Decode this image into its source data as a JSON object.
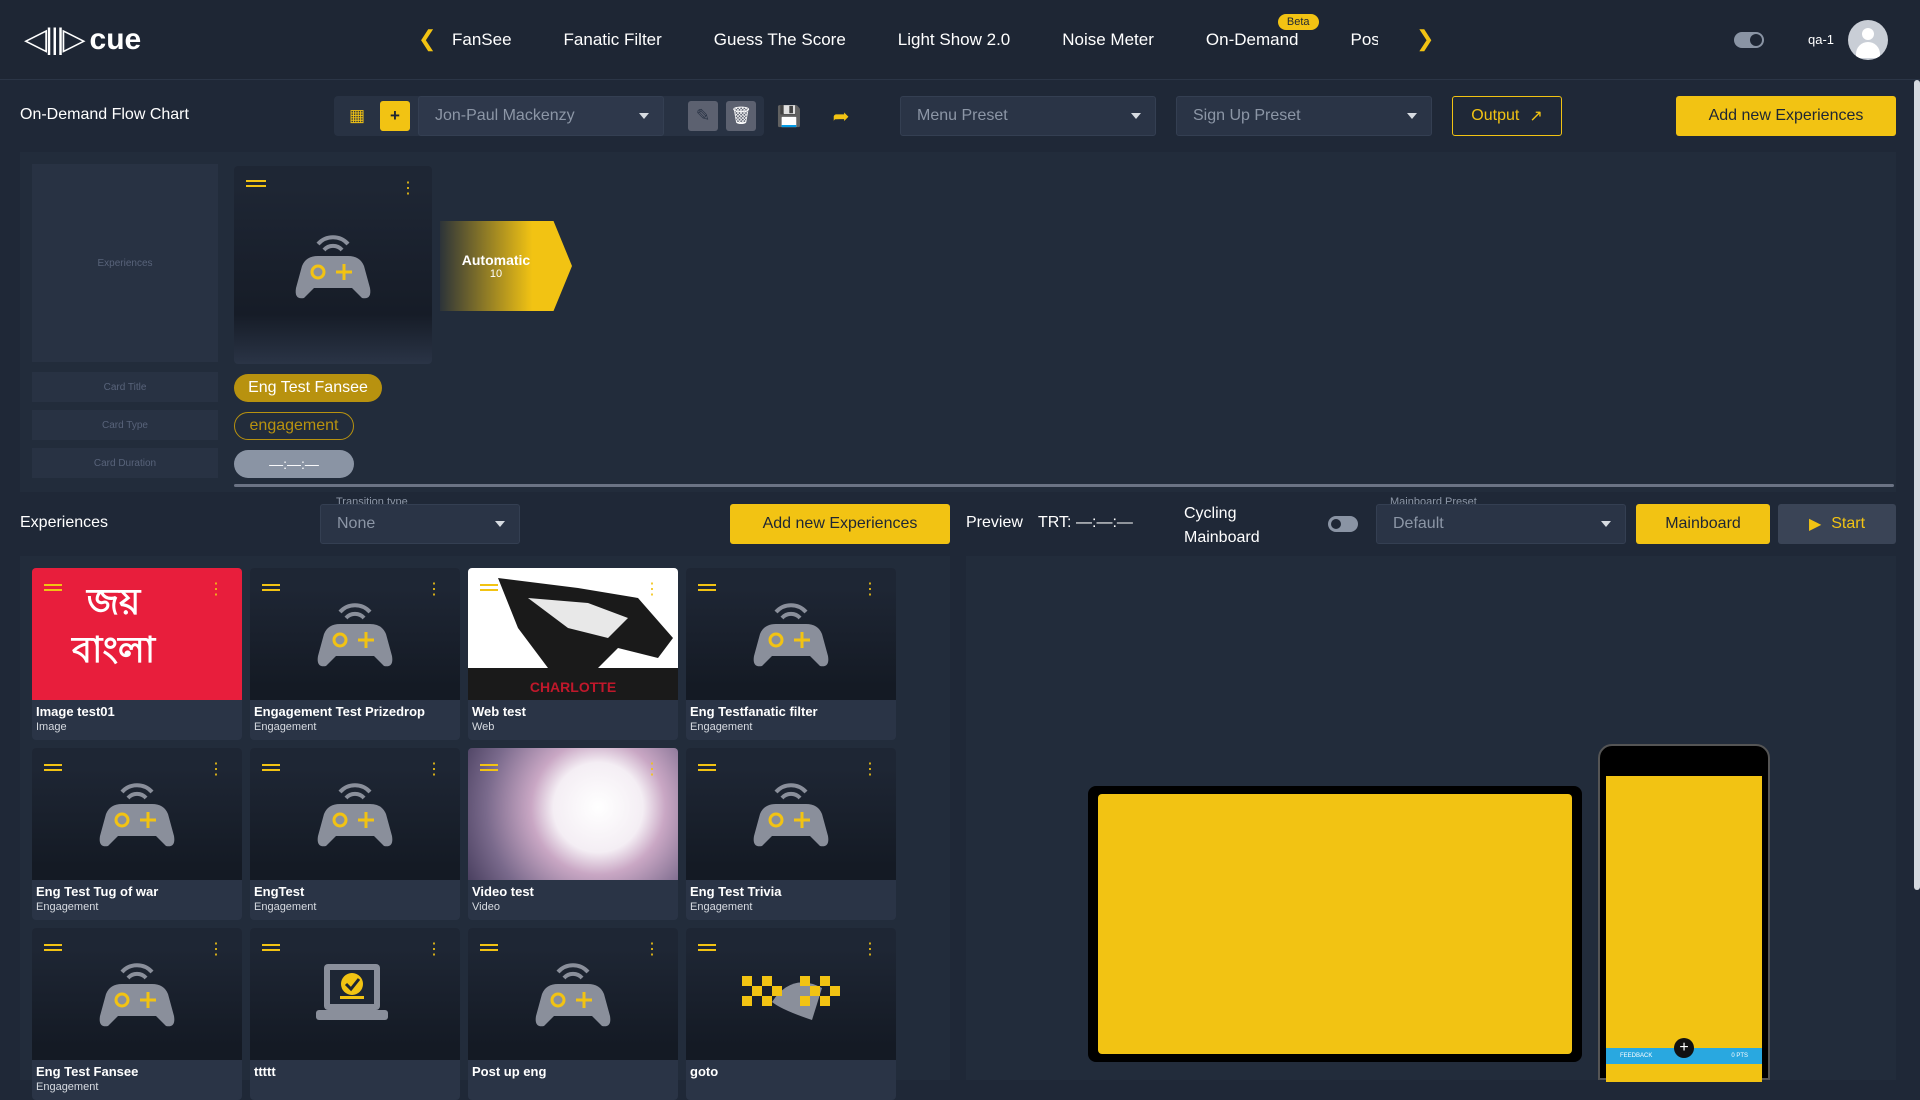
{
  "brand": {
    "name": "cue",
    "mark": "◁|||▷"
  },
  "nav": {
    "items": [
      "FanSee",
      "Fanatic Filter",
      "Guess The Score",
      "Light Show 2.0",
      "Noise Meter",
      "On-Demand",
      "Post"
    ],
    "beta_label": "Beta"
  },
  "user": {
    "name": "qa-1"
  },
  "toolbar": {
    "page_title": "On-Demand Flow Chart",
    "owner": "Jon-Paul Mackenzy",
    "menu_preset": "Menu Preset",
    "signup_preset": "Sign Up Preset",
    "output_label": "Output",
    "add_label": "Add new Experiences"
  },
  "flow": {
    "placeholders": [
      "Experiences",
      "Card Title",
      "Card Type",
      "Card Duration"
    ],
    "card_title": "Eng Test Fansee",
    "card_type": "engagement",
    "card_duration": "—:—:—",
    "transition_label": "Automatic",
    "transition_value": "10"
  },
  "experiences": {
    "title": "Experiences",
    "transition_type_label": "Transition type",
    "transition_type_value": "None",
    "add_label": "Add new Experiences",
    "cards": [
      {
        "title": "Image test01",
        "type": "Image",
        "thumb": "image"
      },
      {
        "title": "Engagement Test Prizedrop",
        "type": "Engagement",
        "thumb": "gamepad"
      },
      {
        "title": "Web test",
        "type": "Web",
        "thumb": "web"
      },
      {
        "title": "Eng Testfanatic filter",
        "type": "Engagement",
        "thumb": "gamepad"
      },
      {
        "title": "Eng Test Tug of war",
        "type": "Engagement",
        "thumb": "gamepad"
      },
      {
        "title": "EngTest",
        "type": "Engagement",
        "thumb": "gamepad"
      },
      {
        "title": "Video test",
        "type": "Video",
        "thumb": "video"
      },
      {
        "title": "Eng Test Trivia",
        "type": "Engagement",
        "thumb": "gamepad"
      },
      {
        "title": "Eng Test Fansee",
        "type": "Engagement",
        "thumb": "gamepad"
      },
      {
        "title": "ttttt",
        "type": "",
        "thumb": "checklist"
      },
      {
        "title": "Post up eng",
        "type": "",
        "thumb": "gamepad"
      },
      {
        "title": "goto",
        "type": "",
        "thumb": "flags"
      }
    ],
    "image_text_line1": "জয়",
    "image_text_line2": "বাংলা",
    "web_text": "CHARLOTTE"
  },
  "preview": {
    "label": "Preview",
    "trt_label": "TRT:",
    "trt_value": "—:—:—",
    "cycling_label": "Cycling Mainboard",
    "mainboard_preset_label": "Mainboard Preset",
    "mainboard_preset_value": "Default",
    "mainboard_button": "Mainboard",
    "start_button": "Start",
    "phone_left": "FEEDBACK",
    "phone_right": "0 PTS"
  },
  "colors": {
    "accent": "#f2c313",
    "bg": "#1f2837",
    "panel": "#222c3b"
  }
}
